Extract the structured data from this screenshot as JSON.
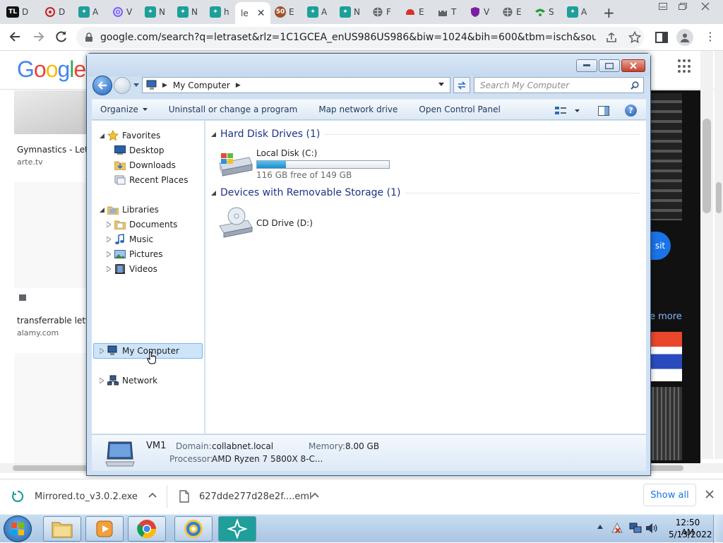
{
  "browser": {
    "tabs": [
      {
        "label": "D",
        "icon": "tl-logo-icon",
        "color": "#111111"
      },
      {
        "label": "D",
        "icon": "target-icon",
        "color": "#c5221f"
      },
      {
        "label": "A",
        "icon": "app-icon",
        "color": "#1e9f9a"
      },
      {
        "label": "V",
        "icon": "at-icon",
        "color": "#7b61ff"
      },
      {
        "label": "N",
        "icon": "app-icon",
        "color": "#1e9f9a"
      },
      {
        "label": "N",
        "icon": "app-icon",
        "color": "#1e9f9a"
      },
      {
        "label": "h",
        "icon": "app-icon",
        "color": "#1e9f9a"
      },
      {
        "label": "le",
        "icon": "blank-icon",
        "color": "#ffffff",
        "active": true
      },
      {
        "label": "E",
        "icon": "badge-icon",
        "color": "#a0522d",
        "badge": "50"
      },
      {
        "label": "A",
        "icon": "app-icon",
        "color": "#1e9f9a"
      },
      {
        "label": "N",
        "icon": "app-icon",
        "color": "#1e9f9a"
      },
      {
        "label": "F",
        "icon": "globe-icon",
        "color": "#5f6368"
      },
      {
        "label": "E",
        "icon": "cloud-icon",
        "color": "#d93025"
      },
      {
        "label": "T",
        "icon": "castle-icon",
        "color": "#5f6368"
      },
      {
        "label": "V",
        "icon": "shield-icon",
        "color": "#7b1fa2"
      },
      {
        "label": "E",
        "icon": "globe-icon",
        "color": "#5f6368"
      },
      {
        "label": "S",
        "icon": "wifi-icon",
        "color": "#2e9b3a"
      },
      {
        "label": "A",
        "icon": "app-icon",
        "color": "#1e9f9a"
      }
    ],
    "url": "google.com/search?q=letraset&rlz=1C1GCEA_enUS986US986&biw=1024&bih=600&tbm=isch&source=lnms&..."
  },
  "google": {
    "logo": "Google",
    "results": [
      {
        "title": "Gymnastics - Letra",
        "source": "arte.tv"
      },
      {
        "title": "transferrable lette",
        "source": "alamy.com"
      }
    ],
    "right_button": "sit",
    "see_more": "e more"
  },
  "explorer": {
    "breadcrumb": "My Computer",
    "search_placeholder": "Search My Computer",
    "commands": [
      "Organize",
      "Uninstall or change a program",
      "Map network drive",
      "Open Control Panel"
    ],
    "nav": {
      "favorites": "Favorites",
      "favorites_items": [
        "Desktop",
        "Downloads",
        "Recent Places"
      ],
      "libraries": "Libraries",
      "libraries_items": [
        "Documents",
        "Music",
        "Pictures",
        "Videos"
      ],
      "computer": "My Computer",
      "network": "Network"
    },
    "groups": [
      {
        "title": "Hard Disk Drives (1)"
      },
      {
        "title": "Devices with Removable Storage (1)"
      }
    ],
    "drives": [
      {
        "name": "Local Disk (C:)",
        "free": "116 GB free of 149 GB",
        "used_fraction": 0.22
      },
      {
        "name": "CD Drive (D:)"
      }
    ],
    "details": {
      "name": "VM1",
      "domain_label": "Domain:",
      "domain": "collabnet.local",
      "memory_label": "Memory:",
      "memory": "8.00 GB",
      "processor_label": "Processor:",
      "processor": "AMD Ryzen 7 5800X 8-C..."
    }
  },
  "downloads": {
    "items": [
      {
        "name": "Mirrored.to_v3.0.2.exe"
      },
      {
        "name": "627dde277d28e2f....eml"
      }
    ],
    "show_all": "Show all"
  },
  "taskbar": {
    "time": "12:50 AM",
    "date": "5/13/2022"
  }
}
